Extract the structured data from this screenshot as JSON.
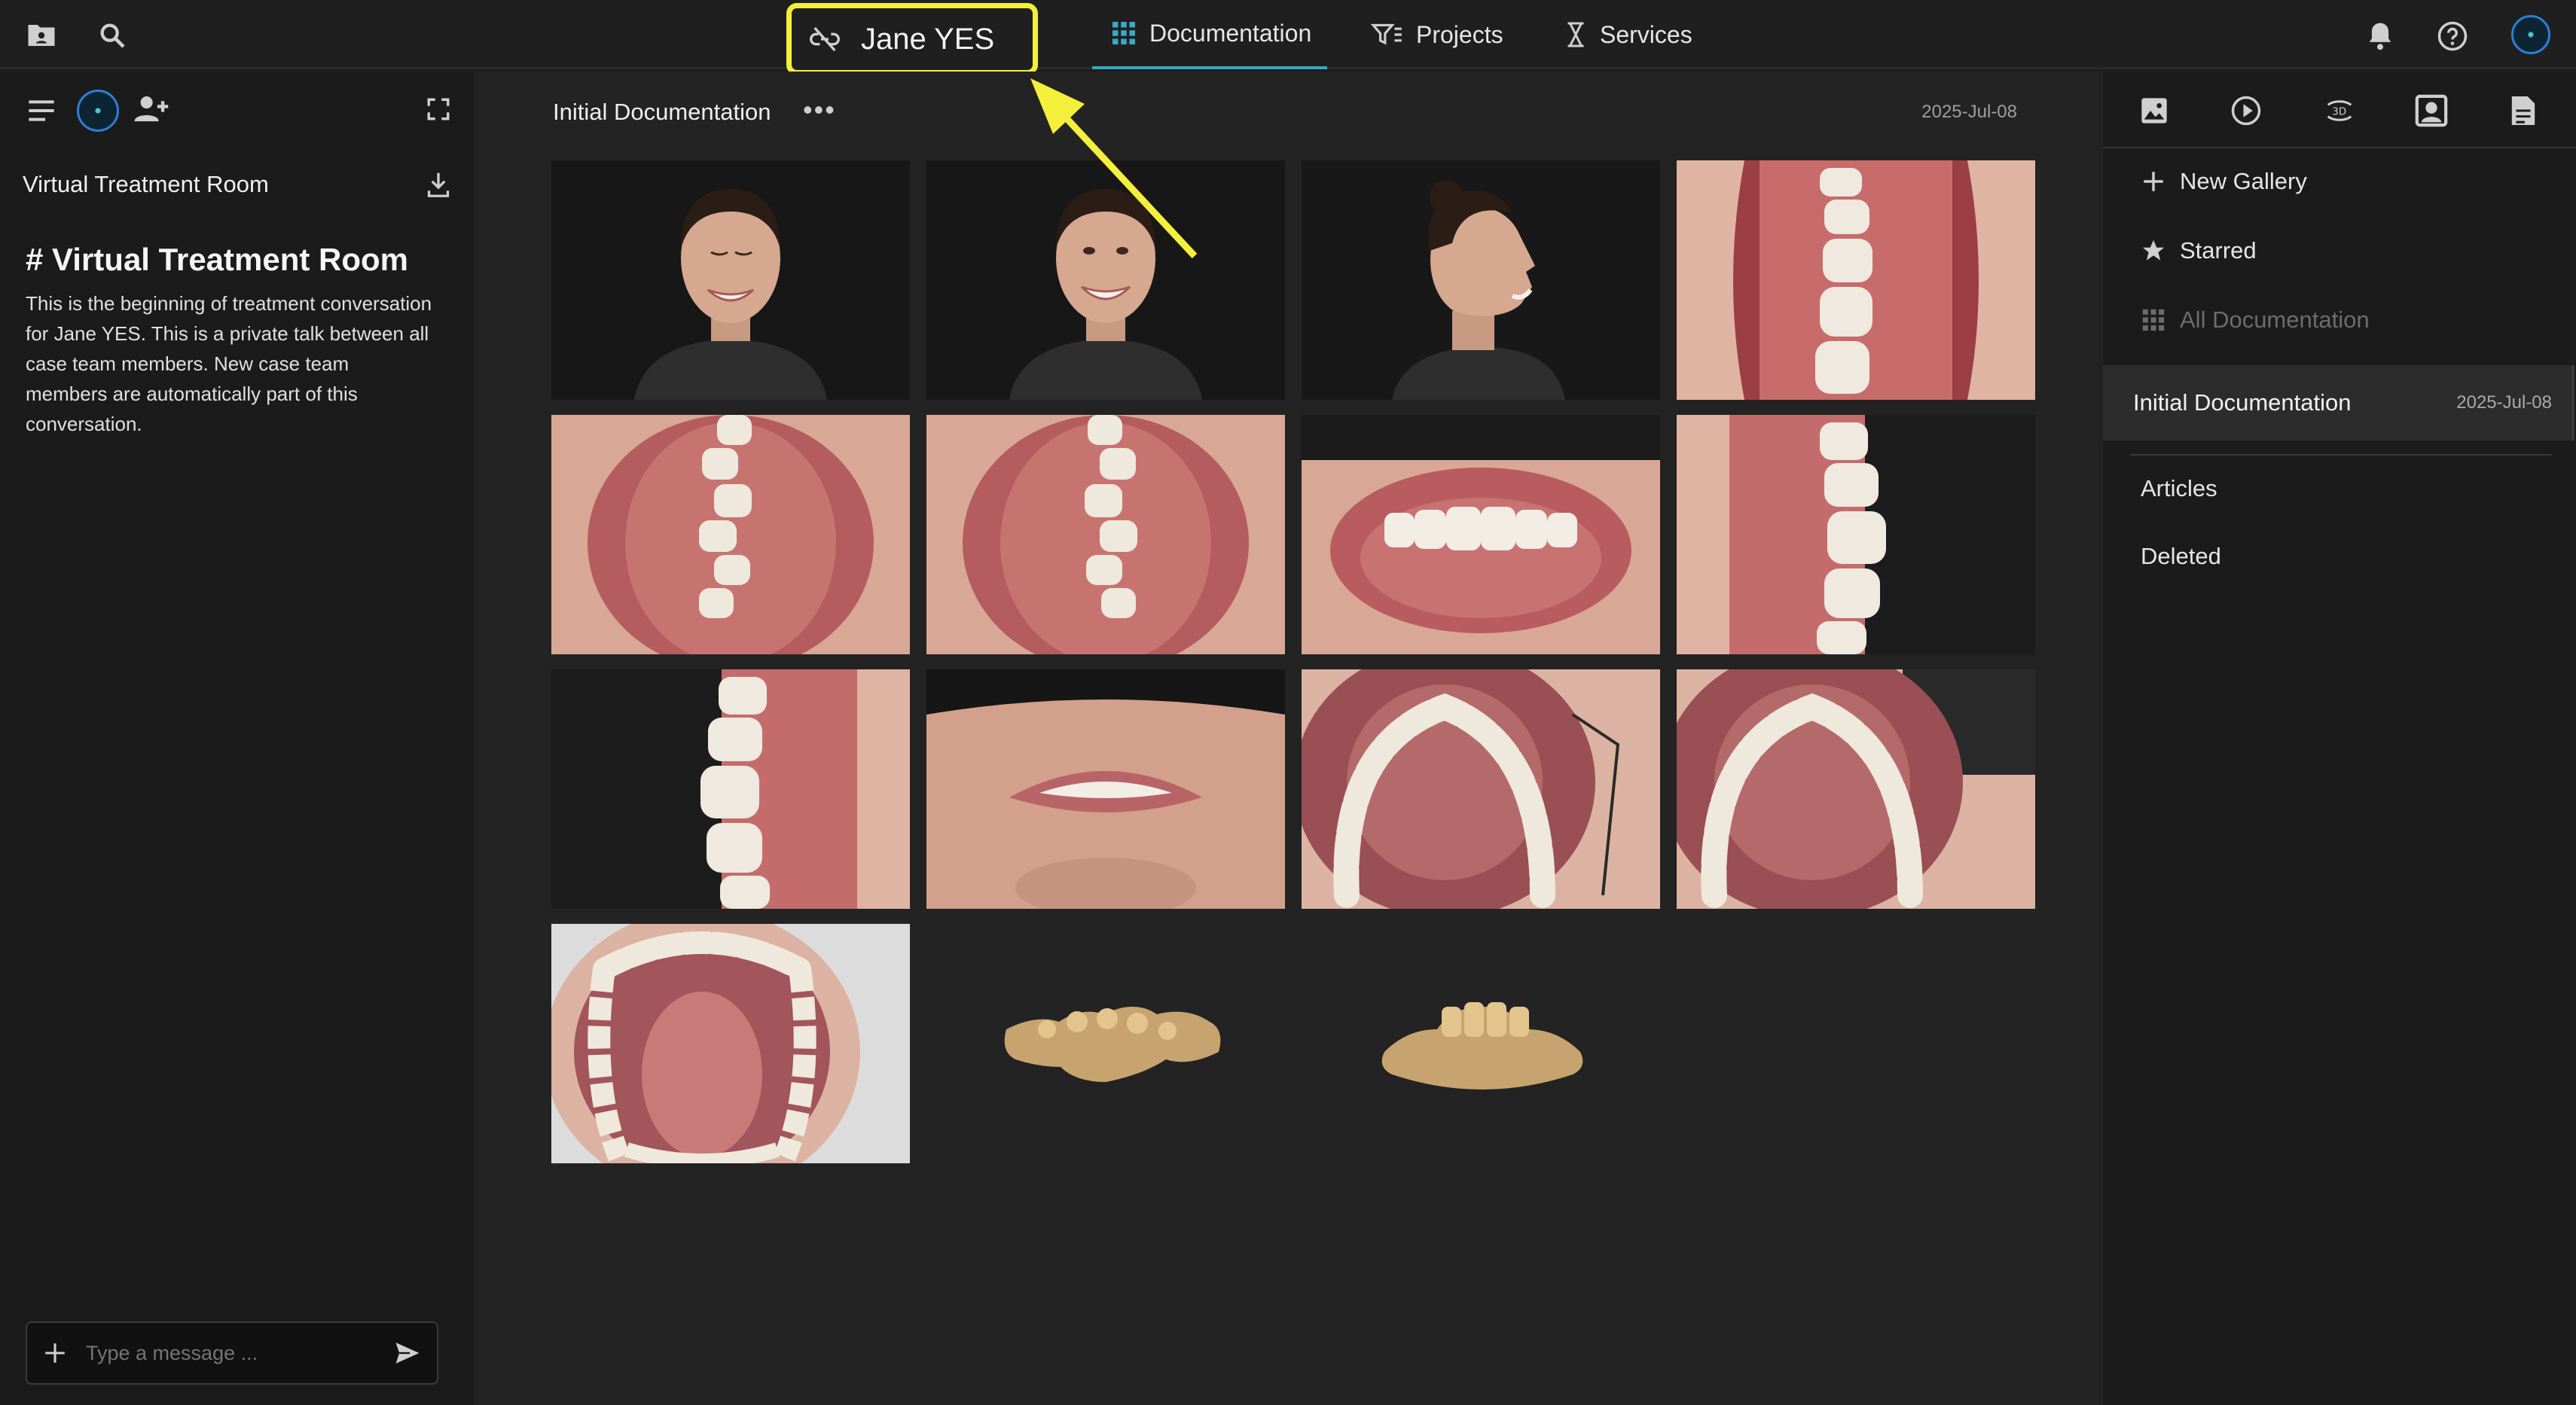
{
  "header": {
    "patient_name": "Jane YES",
    "tabs": [
      {
        "label": "Documentation",
        "icon": "grid-icon"
      },
      {
        "label": "Projects",
        "icon": "projects-icon"
      },
      {
        "label": "Services",
        "icon": "services-icon"
      }
    ],
    "left_icons": [
      "folder-icon",
      "search-icon"
    ],
    "right_icons": [
      "bell-icon",
      "help-icon",
      "user-avatar"
    ],
    "highlight_color": "#f4ef3a",
    "accent_color": "#3aa9c7"
  },
  "left_panel": {
    "room_label": "Virtual Treatment Room",
    "heading": "# Virtual Treatment Room",
    "description": "This is the beginning of treatment conversation for Jane YES. This is a private talk between all case team members. New case team members are automatically part of this conversation.",
    "message_placeholder": "Type a message ..."
  },
  "main": {
    "gallery_title": "Initial Documentation",
    "more_label": "•••",
    "date": "2025-Jul-08",
    "photos": [
      {
        "kind": "face-frontal-closed-eyes"
      },
      {
        "kind": "face-frontal-smile"
      },
      {
        "kind": "face-profile-smile"
      },
      {
        "kind": "upper-teeth-lateral"
      },
      {
        "kind": "occlusal-front-left"
      },
      {
        "kind": "occlusal-front-right"
      },
      {
        "kind": "smile-frontal-retractor"
      },
      {
        "kind": "teeth-lateral-right"
      },
      {
        "kind": "teeth-lateral-left"
      },
      {
        "kind": "lips-from-below"
      },
      {
        "kind": "upper-arch-occlusal-left"
      },
      {
        "kind": "upper-arch-occlusal-right"
      },
      {
        "kind": "lower-arch-occlusal"
      },
      {
        "kind": "scan-3d-upper"
      },
      {
        "kind": "scan-3d-lower"
      }
    ]
  },
  "right_panel": {
    "toolbar_icons": [
      "image-icon",
      "play-icon",
      "3d-rotate-icon",
      "portrait-icon",
      "document-icon"
    ],
    "new_gallery": "New Gallery",
    "starred": "Starred",
    "all_documentation": "All Documentation",
    "selected_gallery": {
      "label": "Initial Documentation",
      "date": "2025-Jul-08"
    },
    "articles": "Articles",
    "deleted": "Deleted"
  }
}
